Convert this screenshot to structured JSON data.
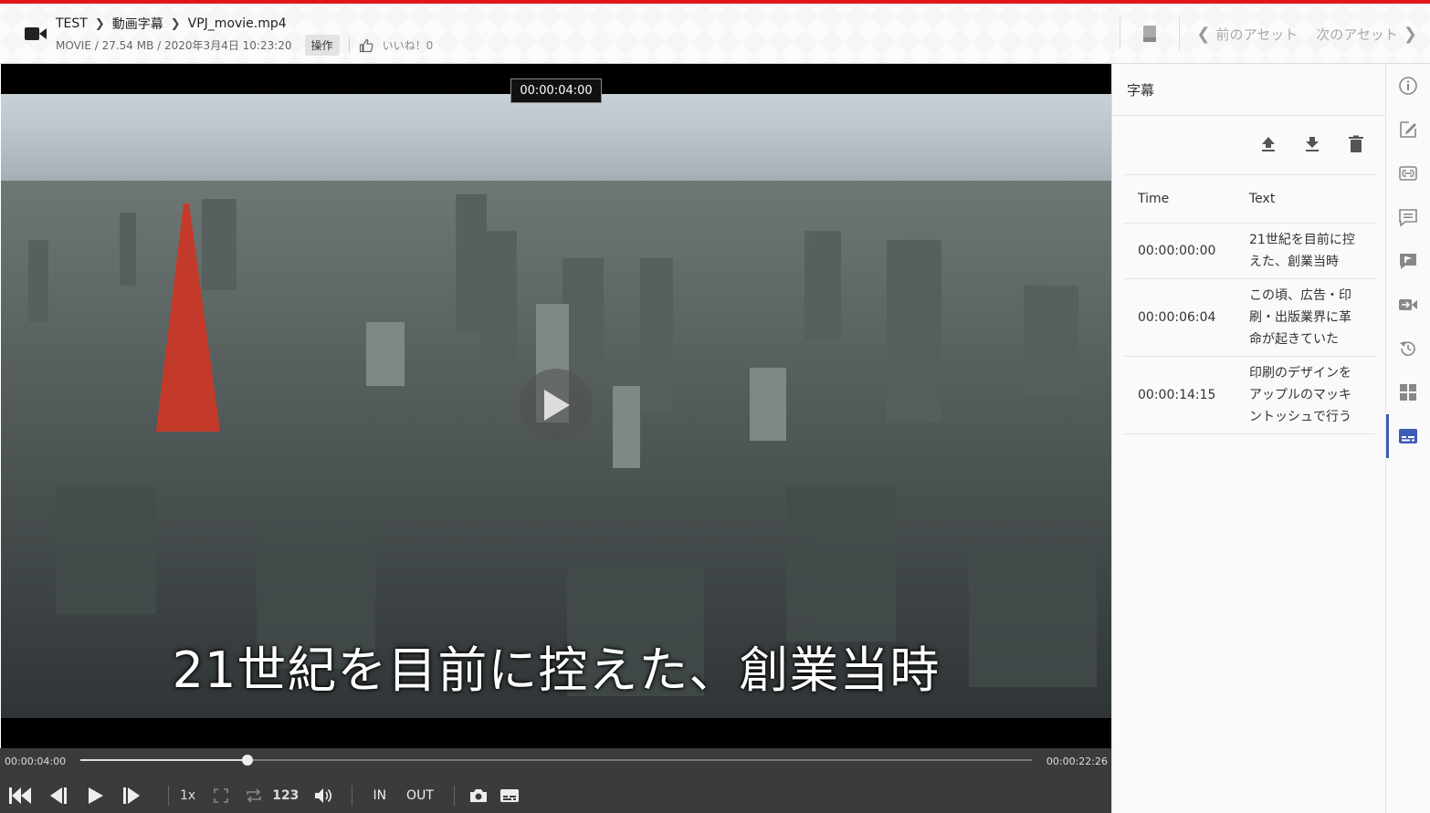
{
  "header": {
    "breadcrumb": [
      "TEST",
      "動画字幕",
      "VPJ_movie.mp4"
    ],
    "meta": "MOVIE / 27.54 MB / 2020年3月4日 10:23:20",
    "operation_label": "操作",
    "like_label": "いいね！0",
    "prev_asset": "前のアセット",
    "next_asset": "次のアセット"
  },
  "video": {
    "time_tooltip": "00:00:04:00",
    "subtitle": "21世紀を目前に控えた、創業当時"
  },
  "controls": {
    "current_time": "00:00:04:00",
    "duration": "00:00:22:26",
    "progress_fraction": 0.176,
    "speed": "1x",
    "frame_label": "123",
    "in_label": "IN",
    "out_label": "OUT"
  },
  "panel": {
    "title": "字幕",
    "columns": [
      "Time",
      "Text"
    ],
    "rows": [
      {
        "time": "00:00:00:00",
        "text": "21世紀を目前に控えた、創業当時"
      },
      {
        "time": "00:00:06:04",
        "text": "この頃、広告・印刷・出版業界に革命が起きていた"
      },
      {
        "time": "00:00:14:15",
        "text": "印刷のデザインをアップルのマッキントッシュで行う"
      }
    ]
  },
  "rail_icons": [
    "info-icon",
    "edit-icon",
    "link-icon",
    "comment-icon",
    "annotation-icon",
    "video-marker-icon",
    "history-icon",
    "grid-icon",
    "subtitles-icon"
  ],
  "colors": {
    "accent_stripe": "#e4141b",
    "active": "#3d5cb8",
    "control_bar": "#3b3b3b"
  }
}
